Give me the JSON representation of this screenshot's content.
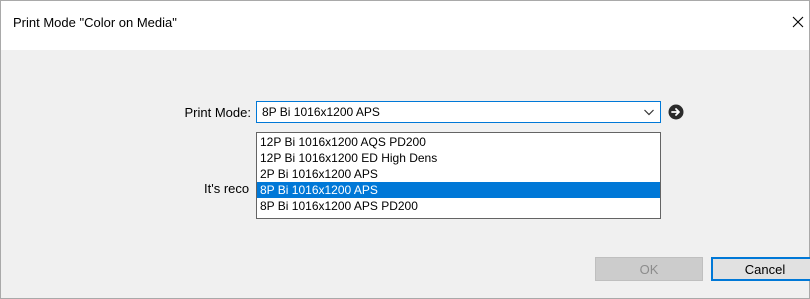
{
  "window": {
    "title": "Print Mode \"Color on Media\""
  },
  "print_mode": {
    "label": "Print Mode:",
    "selected_value": "8P Bi 1016x1200 APS",
    "options": [
      "12P Bi 1016x1200 AQS PD200",
      "12P Bi 1016x1200 ED High Dens",
      "2P Bi 1016x1200 APS",
      "8P Bi 1016x1200 APS",
      "8P Bi 1016x1200 APS PD200"
    ],
    "highlighted_index": 3
  },
  "info_text": "It's reco",
  "buttons": {
    "ok": "OK",
    "cancel": "Cancel"
  },
  "icons": {
    "close": "close-icon",
    "dropdown_arrow": "chevron-down-icon",
    "go": "arrow-right-circle-icon"
  },
  "colors": {
    "accent": "#0078d7",
    "dialog_bg": "#f0f0f0",
    "disabled_button_bg": "#cccccc"
  }
}
